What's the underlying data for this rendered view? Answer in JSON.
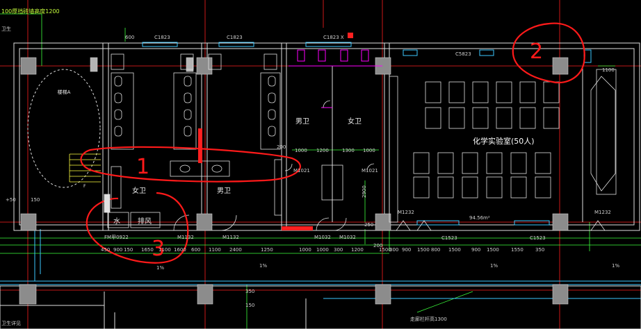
{
  "header": {
    "top_note": "100厚挡砖墙高度1200",
    "left_note": "卫生"
  },
  "windows": {
    "w1": "C1823",
    "w2": "C1823",
    "w3": "C1823 X",
    "w4": "C5823",
    "w5": "C1523",
    "w6": "C1523"
  },
  "rooms": {
    "stair": "楼梯A",
    "female_wc_left": "女卫",
    "male_wc_left": "男卫",
    "male_wc_mid": "男卫",
    "female_wc_mid": "女卫",
    "lab": "化学实验室(50人)",
    "water": "水",
    "pipe": "排风",
    "area": "94.56m²"
  },
  "doors": {
    "fm": "FM甲0922",
    "m1": "M1132",
    "m2": "M1132",
    "m3": "M1032",
    "m4": "M1032",
    "m5": "M1021",
    "m6": "M1021",
    "m7": "M1232",
    "m8": "M1232"
  },
  "dimensions": {
    "bottom_chain": [
      "450",
      "900",
      "150",
      "1650",
      "1100",
      "1600",
      "600",
      "1100",
      "2400",
      "1250",
      "1000",
      "1000",
      "300",
      "1200",
      "1500",
      "300",
      "900",
      "1500",
      "800",
      "1500",
      "900",
      "1500",
      "1550",
      "350"
    ],
    "mid_chain": [
      "1000",
      "1200",
      "1300",
      "1000"
    ],
    "top_small": "600",
    "side_150": "150",
    "side_450": "+50",
    "right_1100": "1100",
    "v_2900": "2900",
    "v_200a": "200",
    "v_200b": "200",
    "v_250": "250",
    "v_350": "350",
    "v_150b": "150",
    "pct1": "1%",
    "pct2": "1%",
    "pct3": "1%",
    "pct4": "1%",
    "bottom_note": "走廊栏杆高1300",
    "bottom_left": "卫生详见"
  },
  "annotations": {
    "mark1": "1",
    "mark2": "2",
    "mark3": "3",
    "color": "#ff1a1a"
  },
  "colors": {
    "background": "#000000",
    "wall": "#e0e0e0",
    "column": "#8c8c8c",
    "axis": "#ff2020",
    "dimension": "#3cff3c",
    "door": "#ff00ff",
    "window": "#3cc8ff"
  }
}
